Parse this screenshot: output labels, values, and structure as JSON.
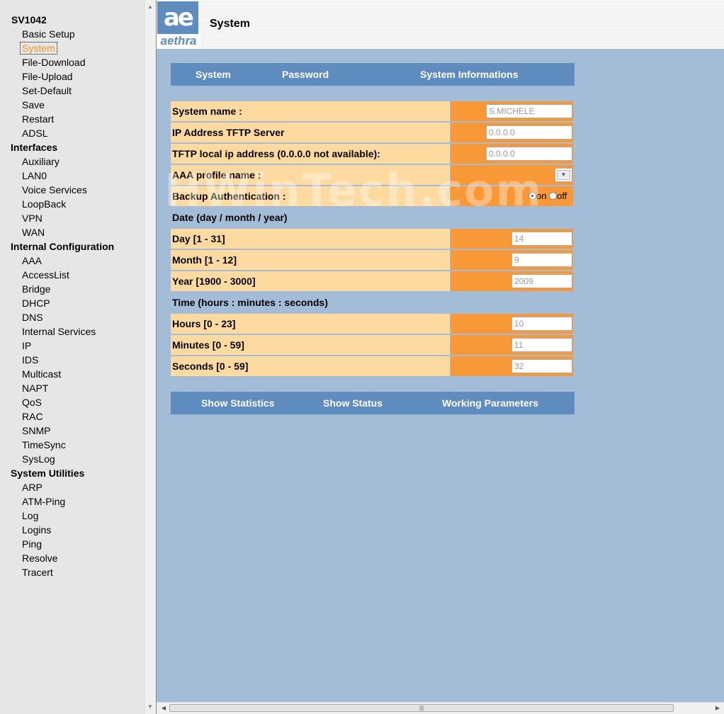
{
  "sidebar": {
    "groups": [
      {
        "title": "SV1042",
        "items": [
          "Basic Setup",
          "System",
          "File-Download",
          "File-Upload",
          "Set-Default",
          "Save",
          "Restart",
          "ADSL"
        ]
      },
      {
        "title": "Interfaces",
        "items": [
          "Auxiliary",
          "LAN0",
          "Voice Services",
          "LoopBack",
          "VPN",
          "WAN"
        ]
      },
      {
        "title": "Internal Configuration",
        "items": [
          "AAA",
          "AccessList",
          "Bridge",
          "DHCP",
          "DNS",
          "Internal Services",
          "IP",
          "IDS",
          "Multicast",
          "NAPT",
          "QoS",
          "RAC",
          "SNMP",
          "TimeSync",
          "SysLog"
        ]
      },
      {
        "title": "System Utilities",
        "items": [
          "ARP",
          "ATM-Ping",
          "Log",
          "Logins",
          "Ping",
          "Resolve",
          "Tracert"
        ]
      }
    ],
    "selected": "System"
  },
  "header": {
    "logo_mark": "ae",
    "logo_text": "aethra",
    "title": "System"
  },
  "top_tabs": [
    "System",
    "Password",
    "System Informations"
  ],
  "form": {
    "system_name": {
      "label": "System name :",
      "value": "S.MICHELE"
    },
    "tftp_server": {
      "label": "IP Address TFTP Server",
      "value": "0.0.0.0"
    },
    "tftp_local": {
      "label": "TFTP local ip address (0.0.0.0 not available):",
      "value": "0.0.0.0"
    },
    "aaa_profile": {
      "label": "AAA profile name :",
      "value": ""
    },
    "backup_auth": {
      "label": "Backup Authentication :",
      "on_label": "on",
      "off_label": "off",
      "selected": "on"
    },
    "date_heading": "Date (day / month / year)",
    "day": {
      "label": "Day [1 - 31]",
      "value": "14"
    },
    "month": {
      "label": "Month [1 - 12]",
      "value": "9"
    },
    "year": {
      "label": "Year [1900 - 3000]",
      "value": "2009"
    },
    "time_heading": "Time (hours : minutes : seconds)",
    "hours": {
      "label": "Hours [0 - 23]",
      "value": "10"
    },
    "minutes": {
      "label": "Minutes [0 - 59]",
      "value": "11"
    },
    "seconds": {
      "label": "Seconds [0 - 59]",
      "value": "32"
    }
  },
  "bottom_tabs": [
    "Show Statistics",
    "Show Status",
    "Working Parameters"
  ],
  "watermark": "HWinTech.com",
  "colors": {
    "bar_blue": "#5f8cbf",
    "label_bg": "#ffdaa0",
    "value_bg": "#f99836",
    "page_bg": "#a3bcd8",
    "selected_item": "#f7941d"
  },
  "icons": {
    "sidebar_scroll_up": "triangle-up-icon",
    "sidebar_scroll_down": "triangle-down-icon",
    "hscroll_left": "triangle-left-icon",
    "hscroll_right": "triangle-right-icon",
    "dropdown": "chevron-down-icon"
  }
}
